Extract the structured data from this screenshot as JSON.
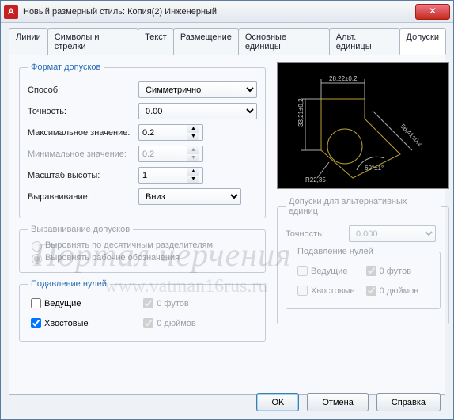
{
  "window": {
    "title": "Новый размерный стиль: Копия(2) Инженерный"
  },
  "tabs": [
    "Линии",
    "Символы и стрелки",
    "Текст",
    "Размещение",
    "Основные единицы",
    "Альт. единицы",
    "Допуски"
  ],
  "format": {
    "legend": "Формат допусков",
    "method_label": "Способ:",
    "method_value": "Симметрично",
    "precision_label": "Точность:",
    "precision_value": "0.00",
    "max_label": "Максимальное значение:",
    "max_value": "0.2",
    "min_label": "Минимальное значение:",
    "min_value": "0.2",
    "scale_label": "Масштаб высоты:",
    "scale_value": "1",
    "align_label": "Выравнивание:",
    "align_value": "Вниз"
  },
  "tol_align": {
    "legend": "Выравнивание допусков",
    "opt1": "Выровнять по десятичным разделителям",
    "opt2": "Выровнять рабочие обозначения"
  },
  "zero_suppress": {
    "legend": "Подавление нулей",
    "leading": "Ведущие",
    "trailing": "Хвостовые",
    "feet": "0 футов",
    "inches": "0 дюймов"
  },
  "alt": {
    "legend": "Допуски для альтернативных единиц",
    "precision_label": "Точность:",
    "precision_value": "0.000",
    "zero_legend": "Подавление нулей",
    "leading": "Ведущие",
    "trailing": "Хвостовые",
    "feet": "0 футов",
    "inches": "0 дюймов"
  },
  "preview": {
    "dim_top": "28,22±0,2",
    "dim_left": "33,21±0,2",
    "dim_right": "56,41±0,2",
    "dim_angle": "60°±1°",
    "dim_radius": "R22,35"
  },
  "buttons": {
    "ok": "OK",
    "cancel": "Отмена",
    "help": "Справка"
  },
  "watermark": {
    "line1": "Портал черчения",
    "line2": "www.vatman16rus.ru"
  }
}
